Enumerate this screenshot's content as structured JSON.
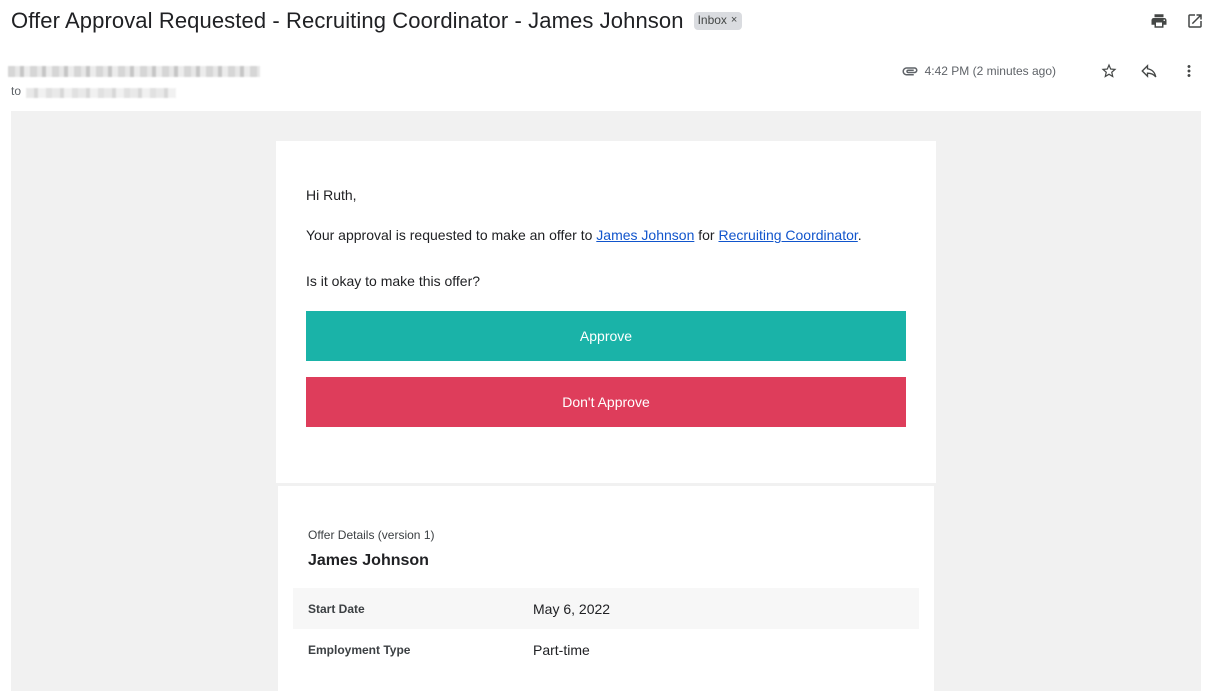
{
  "header": {
    "subject": "Offer Approval Requested - Recruiting Coordinator - James Johnson",
    "label": "Inbox",
    "label_remove": "×",
    "print_icon": "print-icon",
    "open_new_window_icon": "open-in-new-window-icon"
  },
  "sender": {
    "to_label": "to",
    "attachment_icon": "paperclip-icon",
    "timestamp": "4:42 PM (2 minutes ago)",
    "star_icon": "star-outline-icon",
    "reply_icon": "reply-icon",
    "more_icon": "more-vertical-icon"
  },
  "email": {
    "greeting": "Hi Ruth,",
    "request_prefix": "Your approval is requested to make an offer to ",
    "candidate_link": "James Johnson",
    "request_middle": " for ",
    "job_link": "Recruiting Coordinator",
    "request_suffix": ".",
    "question": "Is it okay to make this offer?",
    "approve_label": "Approve",
    "decline_label": "Don't Approve",
    "colors": {
      "approve": "#1ab3a8",
      "decline": "#de3d5b",
      "link": "#1155cc"
    }
  },
  "offer_details": {
    "subtitle": "Offer Details (version 1)",
    "name": "James Johnson",
    "rows": [
      {
        "key": "Start Date",
        "value": "May 6, 2022"
      },
      {
        "key": "Employment Type",
        "value": "Part-time"
      }
    ]
  }
}
